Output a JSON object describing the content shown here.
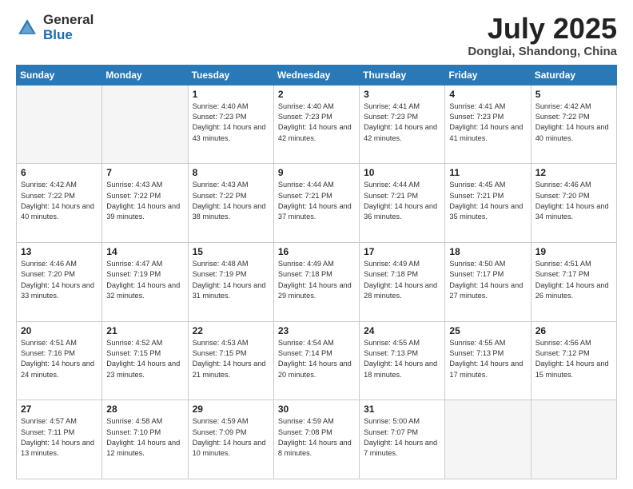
{
  "header": {
    "logo_general": "General",
    "logo_blue": "Blue",
    "month_title": "July 2025",
    "location": "Donglai, Shandong, China"
  },
  "days_of_week": [
    "Sunday",
    "Monday",
    "Tuesday",
    "Wednesday",
    "Thursday",
    "Friday",
    "Saturday"
  ],
  "weeks": [
    [
      {
        "day": "",
        "empty": true
      },
      {
        "day": "",
        "empty": true
      },
      {
        "day": "1",
        "sunrise": "4:40 AM",
        "sunset": "7:23 PM",
        "daylight": "14 hours and 43 minutes."
      },
      {
        "day": "2",
        "sunrise": "4:40 AM",
        "sunset": "7:23 PM",
        "daylight": "14 hours and 42 minutes."
      },
      {
        "day": "3",
        "sunrise": "4:41 AM",
        "sunset": "7:23 PM",
        "daylight": "14 hours and 42 minutes."
      },
      {
        "day": "4",
        "sunrise": "4:41 AM",
        "sunset": "7:23 PM",
        "daylight": "14 hours and 41 minutes."
      },
      {
        "day": "5",
        "sunrise": "4:42 AM",
        "sunset": "7:22 PM",
        "daylight": "14 hours and 40 minutes."
      }
    ],
    [
      {
        "day": "6",
        "sunrise": "4:42 AM",
        "sunset": "7:22 PM",
        "daylight": "14 hours and 40 minutes."
      },
      {
        "day": "7",
        "sunrise": "4:43 AM",
        "sunset": "7:22 PM",
        "daylight": "14 hours and 39 minutes."
      },
      {
        "day": "8",
        "sunrise": "4:43 AM",
        "sunset": "7:22 PM",
        "daylight": "14 hours and 38 minutes."
      },
      {
        "day": "9",
        "sunrise": "4:44 AM",
        "sunset": "7:21 PM",
        "daylight": "14 hours and 37 minutes."
      },
      {
        "day": "10",
        "sunrise": "4:44 AM",
        "sunset": "7:21 PM",
        "daylight": "14 hours and 36 minutes."
      },
      {
        "day": "11",
        "sunrise": "4:45 AM",
        "sunset": "7:21 PM",
        "daylight": "14 hours and 35 minutes."
      },
      {
        "day": "12",
        "sunrise": "4:46 AM",
        "sunset": "7:20 PM",
        "daylight": "14 hours and 34 minutes."
      }
    ],
    [
      {
        "day": "13",
        "sunrise": "4:46 AM",
        "sunset": "7:20 PM",
        "daylight": "14 hours and 33 minutes."
      },
      {
        "day": "14",
        "sunrise": "4:47 AM",
        "sunset": "7:19 PM",
        "daylight": "14 hours and 32 minutes."
      },
      {
        "day": "15",
        "sunrise": "4:48 AM",
        "sunset": "7:19 PM",
        "daylight": "14 hours and 31 minutes."
      },
      {
        "day": "16",
        "sunrise": "4:49 AM",
        "sunset": "7:18 PM",
        "daylight": "14 hours and 29 minutes."
      },
      {
        "day": "17",
        "sunrise": "4:49 AM",
        "sunset": "7:18 PM",
        "daylight": "14 hours and 28 minutes."
      },
      {
        "day": "18",
        "sunrise": "4:50 AM",
        "sunset": "7:17 PM",
        "daylight": "14 hours and 27 minutes."
      },
      {
        "day": "19",
        "sunrise": "4:51 AM",
        "sunset": "7:17 PM",
        "daylight": "14 hours and 26 minutes."
      }
    ],
    [
      {
        "day": "20",
        "sunrise": "4:51 AM",
        "sunset": "7:16 PM",
        "daylight": "14 hours and 24 minutes."
      },
      {
        "day": "21",
        "sunrise": "4:52 AM",
        "sunset": "7:15 PM",
        "daylight": "14 hours and 23 minutes."
      },
      {
        "day": "22",
        "sunrise": "4:53 AM",
        "sunset": "7:15 PM",
        "daylight": "14 hours and 21 minutes."
      },
      {
        "day": "23",
        "sunrise": "4:54 AM",
        "sunset": "7:14 PM",
        "daylight": "14 hours and 20 minutes."
      },
      {
        "day": "24",
        "sunrise": "4:55 AM",
        "sunset": "7:13 PM",
        "daylight": "14 hours and 18 minutes."
      },
      {
        "day": "25",
        "sunrise": "4:55 AM",
        "sunset": "7:13 PM",
        "daylight": "14 hours and 17 minutes."
      },
      {
        "day": "26",
        "sunrise": "4:56 AM",
        "sunset": "7:12 PM",
        "daylight": "14 hours and 15 minutes."
      }
    ],
    [
      {
        "day": "27",
        "sunrise": "4:57 AM",
        "sunset": "7:11 PM",
        "daylight": "14 hours and 13 minutes."
      },
      {
        "day": "28",
        "sunrise": "4:58 AM",
        "sunset": "7:10 PM",
        "daylight": "14 hours and 12 minutes."
      },
      {
        "day": "29",
        "sunrise": "4:59 AM",
        "sunset": "7:09 PM",
        "daylight": "14 hours and 10 minutes."
      },
      {
        "day": "30",
        "sunrise": "4:59 AM",
        "sunset": "7:08 PM",
        "daylight": "14 hours and 8 minutes."
      },
      {
        "day": "31",
        "sunrise": "5:00 AM",
        "sunset": "7:07 PM",
        "daylight": "14 hours and 7 minutes."
      },
      {
        "day": "",
        "empty": true
      },
      {
        "day": "",
        "empty": true
      }
    ]
  ]
}
